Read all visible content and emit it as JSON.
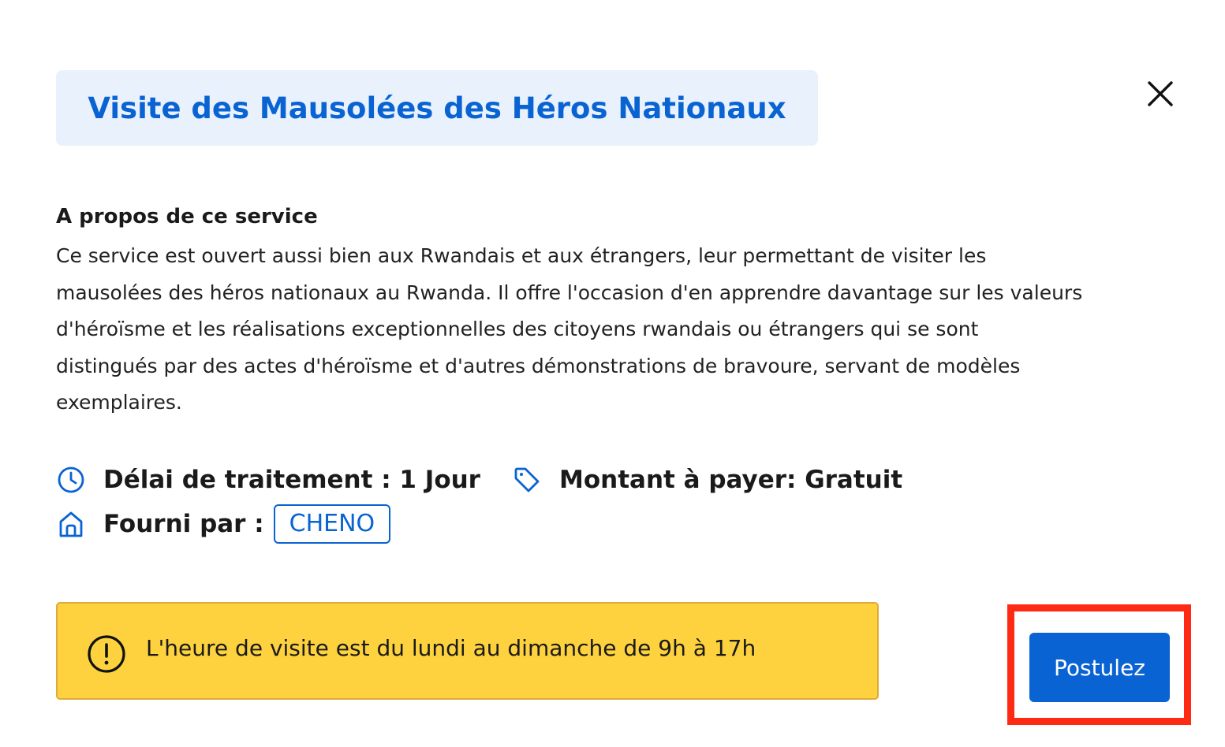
{
  "dialog": {
    "title": "Visite des Mausolées des Héros Nationaux",
    "close_icon": "close-icon"
  },
  "about": {
    "heading": "A propos de ce service",
    "lines": [
      "Ce service est ouvert aussi bien aux Rwandais et aux étrangers, leur permettant de visiter les",
      "mausolées des héros nationaux au Rwanda. Il offre l'occasion d'en apprendre davantage sur les valeurs",
      "d'héroïsme et les réalisations exceptionnelles des citoyens rwandais ou étrangers qui se sont",
      "distingués par des actes d'héroïsme et d'autres démonstrations de bravoure, servant de modèles",
      "exemplaires."
    ]
  },
  "meta": {
    "processing_time": "Délai de traitement : 1 Jour",
    "processing_icon": "clock-icon",
    "amount": "Montant à payer: Gratuit",
    "amount_icon": "tag-icon",
    "provider_label": "Fourni par :",
    "provider_icon": "home-icon",
    "provider_name": "CHENO"
  },
  "alert": {
    "icon": "exclamation-circle-icon",
    "text": "L'heure de visite est du lundi au dimanche de 9h à 17h"
  },
  "actions": {
    "apply_label": "Postulez"
  },
  "colors": {
    "primary": "#0a63d2",
    "title_bg": "#e9f2fc",
    "alert_bg": "#fdd23e",
    "alert_border": "#e0a93a",
    "highlight": "#ff2a14"
  }
}
